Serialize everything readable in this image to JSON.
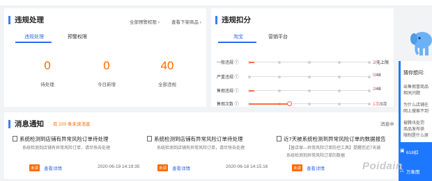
{
  "violations": {
    "title": "违规处理",
    "link_rules": "全部预警权限 ›",
    "link_down": "查看下架商品 ›",
    "tabs": [
      "违规处理",
      "预警权限"
    ],
    "stats": [
      {
        "value": "0",
        "label": "待处理"
      },
      {
        "value": "0",
        "label": "今日新增"
      },
      {
        "value": "40",
        "label": "全部违规"
      }
    ]
  },
  "penalty": {
    "title": "违规扣分",
    "tabs": [
      "淘宝",
      "营销平台"
    ],
    "rows": [
      {
        "label": "一般违规 ⓘ",
        "current": "2",
        "max": "/无上限",
        "fraction": 0.04
      },
      {
        "label": "严重违规 ⓘ",
        "current": "0",
        "max": "/48",
        "fraction": 0
      },
      {
        "label": "售假违规 ⓘ",
        "current": "2",
        "max": "/48",
        "fraction": 0.04
      },
      {
        "label": "售假次数 ⓘ",
        "current": "1次",
        "max": "/3次",
        "fraction": 0.33
      }
    ]
  },
  "messages": {
    "title": "消息通知",
    "unread": "有 220 条未读消息",
    "center_link": "消息中",
    "items": [
      {
        "title": "系统检测到店铺有异常风险订单待处理",
        "desc": "系统检测到店铺有异常风险订单，请尽快去处理",
        "badge": "未读",
        "link": "查看详情",
        "time": "2020-06-19 14:19:35"
      },
      {
        "title": "系统检测到店铺有异常风险订单待处理",
        "desc": "系统检测到店铺有异常风险订单，请尽快去处理",
        "badge": "未读",
        "link": "查看详情",
        "time": "2020-06-18 14:15:16"
      },
      {
        "title": "近7天被系统检测到异常风险订单的数据报告",
        "desc": "【普店保—异常风险订单防控工具】提醒您近7天被",
        "desc2": "系统检测到异常风险订单的数据",
        "badge": "未读",
        "link": "查看详情",
        "time": ""
      }
    ]
  },
  "help": {
    "title": "猜你想问:",
    "q1a": "出售假冒商品",
    "q1b": "相关问题",
    "q2a": "为什么店铺在",
    "q2b": "网上搜索不到",
    "q3a": "被腾讯处罚",
    "q3b": "商品发布供",
    "q3c": "限制是什么原",
    "bottom1": "618扣",
    "bottom2": "万象图"
  },
  "watermark": "Poidain"
}
